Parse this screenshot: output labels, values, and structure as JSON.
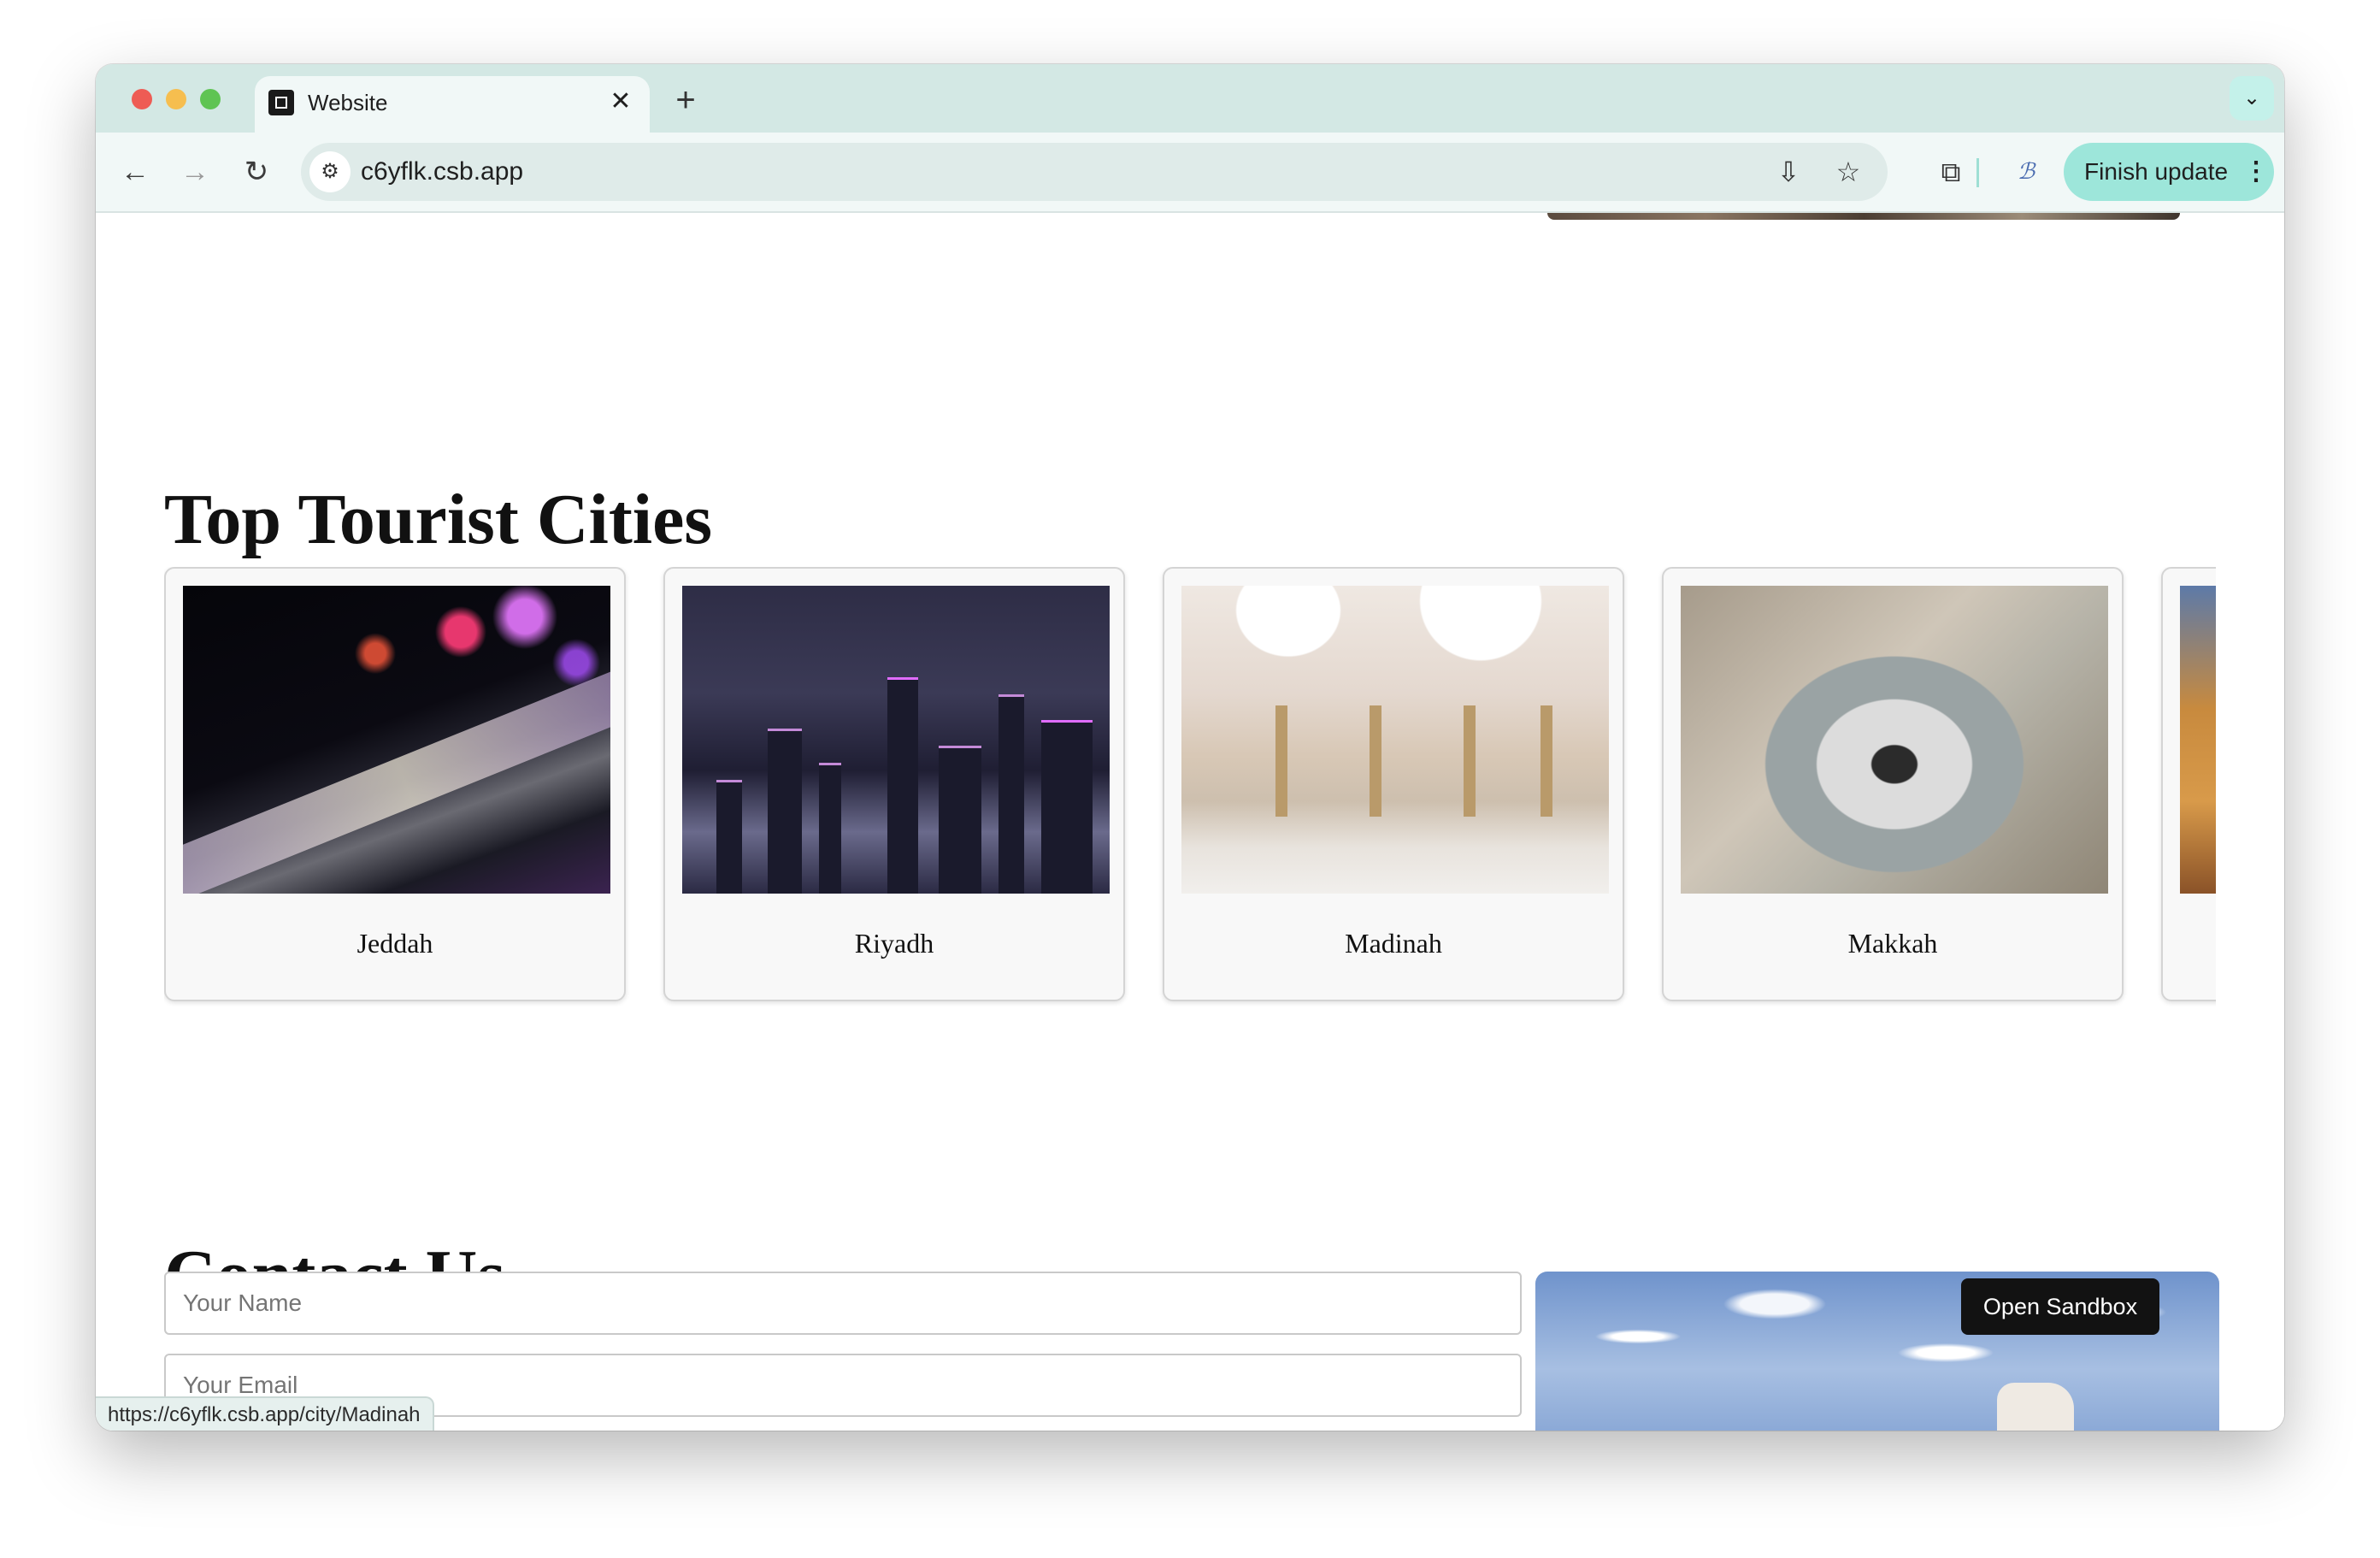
{
  "browser": {
    "tab_title": "Website",
    "tab_close": "✕",
    "new_tab": "+",
    "url": "c6yflk.csb.app",
    "finish_update_label": "Finish update",
    "status_url": "https://c6yflk.csb.app/city/Madinah"
  },
  "icons": {
    "back": "←",
    "forward": "→",
    "reload": "↻",
    "site_info": "⚙",
    "install": "⇩",
    "star": "☆",
    "extensions": "⧉",
    "profile": "ℬ",
    "menu": "⋮",
    "tab_search": "⌄"
  },
  "page": {
    "cities_heading": "Top Tourist Cities",
    "cities": [
      {
        "name": "Jeddah"
      },
      {
        "name": "Riyadh"
      },
      {
        "name": "Madinah"
      },
      {
        "name": "Makkah"
      },
      {
        "name": ""
      }
    ],
    "contact_heading": "Contact Us",
    "contact": {
      "name_placeholder": "Your Name",
      "email_placeholder": "Your Email"
    }
  },
  "sandbox_button_label": "Open Sandbox",
  "colors": {
    "tabstrip": "#d3e8e4",
    "toolbar": "#f1f8f7",
    "finish_update": "#9de6da",
    "sandbox_button": "#121212"
  }
}
